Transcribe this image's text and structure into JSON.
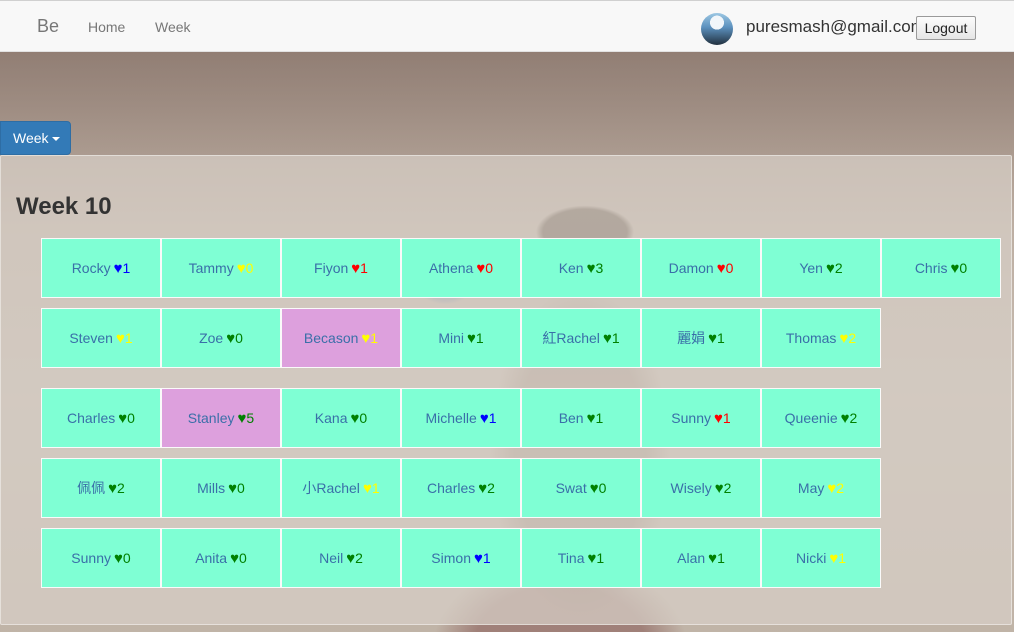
{
  "navbar": {
    "brand": "Be",
    "links": [
      "Home",
      "Week"
    ],
    "user_email": "puresmash@gmail.com",
    "logout_label": "Logout"
  },
  "week_dropdown_label": "Week",
  "week_title": "Week 10",
  "colors": {
    "cell_default": "#7fffd4",
    "cell_active": "#dda0dd",
    "name_text": "#3a6fa8",
    "heart_green": "#008000",
    "heart_blue": "#0000ff",
    "heart_red": "#ff0000",
    "heart_yellow": "#ffff00"
  },
  "icons": {
    "heart": "heart-icon",
    "caret": "chevron-down-icon",
    "avatar": "avatar"
  },
  "rows": [
    [
      {
        "name": "Rocky",
        "heart": "blue",
        "count": "1",
        "active": false
      },
      {
        "name": "Tammy",
        "heart": "yellow",
        "count": "0",
        "active": false
      },
      {
        "name": "Fiyon",
        "heart": "red",
        "count": "1",
        "active": false
      },
      {
        "name": "Athena",
        "heart": "red",
        "count": "0",
        "active": false
      },
      {
        "name": "Ken",
        "heart": "green",
        "count": "3",
        "active": false
      },
      {
        "name": "Damon",
        "heart": "red",
        "count": "0",
        "active": false
      },
      {
        "name": "Yen",
        "heart": "green",
        "count": "2",
        "active": false
      },
      {
        "name": "Chris",
        "heart": "green",
        "count": "0",
        "active": false
      }
    ],
    [
      {
        "name": "Steven",
        "heart": "yellow",
        "count": "1",
        "active": false
      },
      {
        "name": "Zoe",
        "heart": "green",
        "count": "0",
        "active": false
      },
      {
        "name": "Becason",
        "heart": "yellow",
        "count": "1",
        "active": true
      },
      {
        "name": "Mini",
        "heart": "green",
        "count": "1",
        "active": false
      },
      {
        "name": "紅Rachel",
        "heart": "green",
        "count": "1",
        "active": false
      },
      {
        "name": "麗娟",
        "heart": "green",
        "count": "1",
        "active": false
      },
      {
        "name": "Thomas",
        "heart": "yellow",
        "count": "2",
        "active": false
      }
    ],
    [
      {
        "name": "Charles",
        "heart": "green",
        "count": "0",
        "active": false
      },
      {
        "name": "Stanley",
        "heart": "green",
        "count": "5",
        "active": true
      },
      {
        "name": "Kana",
        "heart": "green",
        "count": "0",
        "active": false
      },
      {
        "name": "Michelle",
        "heart": "blue",
        "count": "1",
        "active": false
      },
      {
        "name": "Ben",
        "heart": "green",
        "count": "1",
        "active": false
      },
      {
        "name": "Sunny",
        "heart": "red",
        "count": "1",
        "active": false
      },
      {
        "name": "Queenie",
        "heart": "green",
        "count": "2",
        "active": false
      }
    ],
    [
      {
        "name": "佩佩",
        "heart": "green",
        "count": "2",
        "active": false
      },
      {
        "name": "Mills",
        "heart": "green",
        "count": "0",
        "active": false
      },
      {
        "name": "小Rachel",
        "heart": "yellow",
        "count": "1",
        "active": false
      },
      {
        "name": "Charles",
        "heart": "green",
        "count": "2",
        "active": false
      },
      {
        "name": "Swat",
        "heart": "green",
        "count": "0",
        "active": false
      },
      {
        "name": "Wisely",
        "heart": "green",
        "count": "2",
        "active": false
      },
      {
        "name": "May",
        "heart": "yellow",
        "count": "2",
        "active": false
      }
    ],
    [
      {
        "name": "Sunny",
        "heart": "green",
        "count": "0",
        "active": false
      },
      {
        "name": "Anita",
        "heart": "green",
        "count": "0",
        "active": false
      },
      {
        "name": "Neil",
        "heart": "green",
        "count": "2",
        "active": false
      },
      {
        "name": "Simon",
        "heart": "blue",
        "count": "1",
        "active": false
      },
      {
        "name": "Tina",
        "heart": "green",
        "count": "1",
        "active": false
      },
      {
        "name": "Alan",
        "heart": "green",
        "count": "1",
        "active": false
      },
      {
        "name": "Nicki",
        "heart": "yellow",
        "count": "1",
        "active": false
      }
    ]
  ]
}
